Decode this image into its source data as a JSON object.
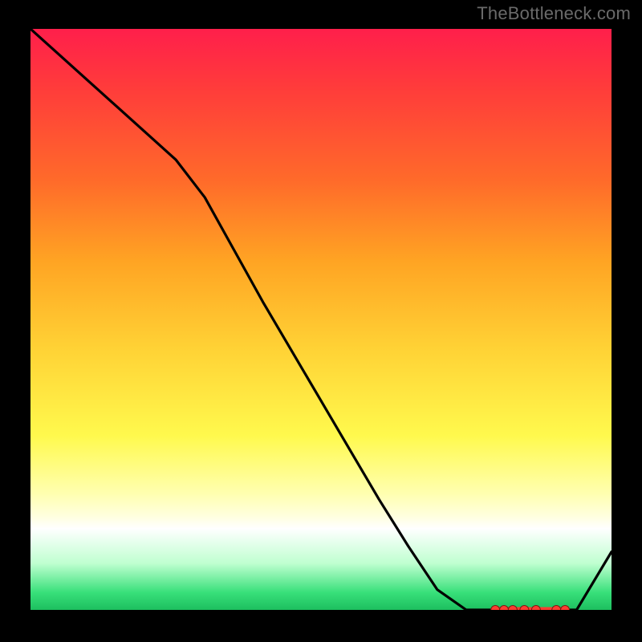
{
  "watermark": "TheBottleneck.com",
  "chart_data": {
    "type": "line",
    "x": [
      0.0,
      0.05,
      0.1,
      0.15,
      0.2,
      0.25,
      0.3,
      0.35,
      0.4,
      0.45,
      0.5,
      0.55,
      0.6,
      0.65,
      0.7,
      0.75,
      0.8,
      0.82,
      0.86,
      0.9,
      0.94,
      1.0
    ],
    "y": [
      1.0,
      0.955,
      0.91,
      0.865,
      0.82,
      0.775,
      0.71,
      0.62,
      0.53,
      0.445,
      0.36,
      0.275,
      0.19,
      0.11,
      0.035,
      0.0,
      0.0,
      0.0,
      0.0,
      0.0,
      0.0,
      0.1
    ],
    "optimum_segment": {
      "x_start": 0.8,
      "x_end": 0.92,
      "y": 0.0
    },
    "title": "",
    "xlabel": "",
    "ylabel": "",
    "xlim": [
      0,
      1
    ],
    "ylim": [
      0,
      1
    ],
    "annotations": [
      "TheBottleneck.com"
    ]
  },
  "colors": {
    "line": "#000000",
    "marker_fill": "#ff3b30",
    "marker_stroke": "#7a1a12"
  }
}
